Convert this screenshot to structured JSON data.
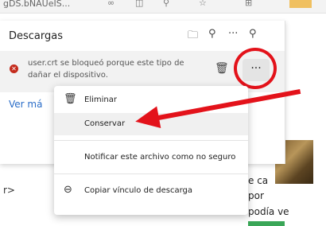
{
  "toolbar": {
    "tab_text": "gDS.bNAUeIS..."
  },
  "downloads": {
    "title": "Descargas",
    "item_message": "user.crt se bloqueó porque este tipo de archivo puede dañar el dispositivo.",
    "item_line1": "user.crt se bloqueó porque este tipo de",
    "item_line2": "dañar el dispositivo.",
    "more_label": "···",
    "see_more": "Ver má"
  },
  "context_menu": {
    "items": [
      {
        "label": "Eliminar",
        "icon": "trash-icon"
      },
      {
        "label": "Conservar",
        "icon": ""
      },
      {
        "label": "Notificar este archivo como no seguro",
        "icon": ""
      },
      {
        "label": "Copiar vínculo de descarga",
        "icon": "link-icon"
      }
    ]
  },
  "background": {
    "left_text": "r>",
    "right_line1": "e ca",
    "right_line2": "por",
    "right_line3": "podía ve"
  },
  "colors": {
    "annotation": "#e3121a",
    "error": "#c42b1c",
    "link": "#2a6dc8"
  }
}
